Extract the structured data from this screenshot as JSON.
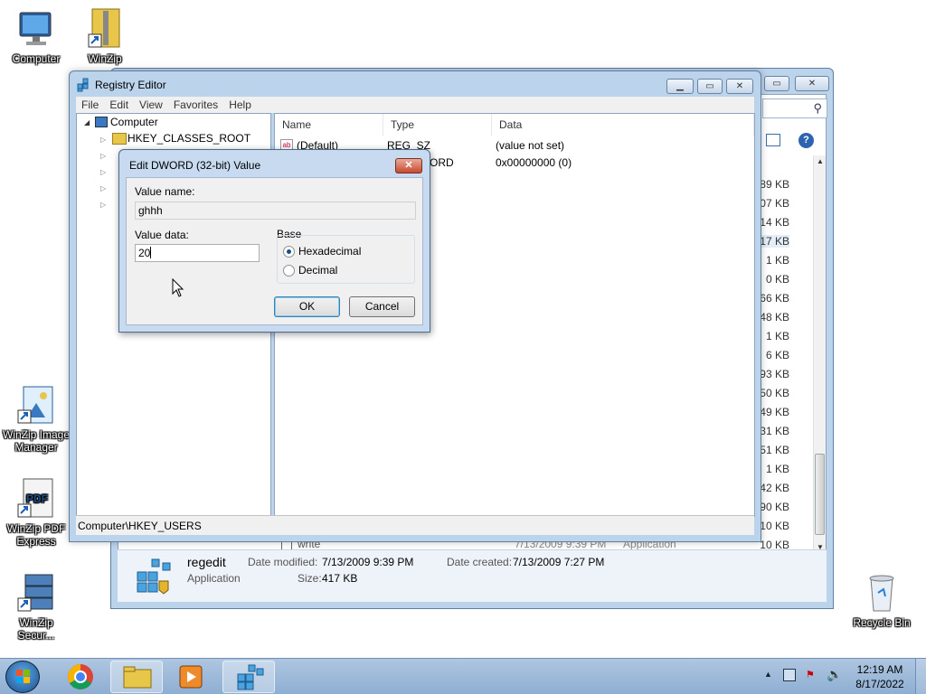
{
  "desktop": {
    "icons": [
      {
        "label": "Computer"
      },
      {
        "label": "WinZip"
      },
      {
        "label": "WinZip Image Manager"
      },
      {
        "label": "WinZip PDF Express"
      },
      {
        "label": "WinZip Secur..."
      },
      {
        "label": "Recycle Bin"
      }
    ]
  },
  "explorer": {
    "sizes": [
      "89 KB",
      "07 KB",
      "14 KB",
      "17 KB",
      "1 KB",
      "0 KB",
      "66 KB",
      "48 KB",
      "1 KB",
      "6 KB",
      "93 KB",
      "50 KB",
      "49 KB",
      "31 KB",
      "51 KB",
      "1 KB",
      "42 KB",
      "90 KB",
      "10 KB",
      "10 KB"
    ],
    "last_row": {
      "name": "write",
      "date": "7/13/2009 9:39 PM",
      "type": "Application"
    },
    "details": {
      "name": "regedit",
      "type": "Application",
      "modified_label": "Date modified:",
      "modified_value": "7/13/2009 9:39 PM",
      "created_label": "Date created:",
      "created_value": "7/13/2009 7:27 PM",
      "size_label": "Size:",
      "size_value": "417 KB"
    }
  },
  "regedit": {
    "title": "Registry Editor",
    "menu": [
      "File",
      "Edit",
      "View",
      "Favorites",
      "Help"
    ],
    "tree": {
      "root": "Computer",
      "first_key": "HKEY_CLASSES_ROOT"
    },
    "columns": {
      "name": "Name",
      "type": "Type",
      "data": "Data"
    },
    "rows": [
      {
        "name": "(Default)",
        "type": "REG_SZ",
        "data": "(value not set)"
      },
      {
        "name": "",
        "type": "ORD",
        "data": "0x00000000 (0)"
      }
    ],
    "status": "Computer\\HKEY_USERS"
  },
  "dialog": {
    "title": "Edit DWORD (32-bit) Value",
    "value_name_label": "Value name:",
    "value_name": "ghhh",
    "value_data_label": "Value data:",
    "value_data": "20",
    "base_label": "Base",
    "hex_label": "Hexadecimal",
    "dec_label": "Decimal",
    "ok": "OK",
    "cancel": "Cancel"
  },
  "taskbar": {
    "time": "12:19 AM",
    "date": "8/17/2022"
  }
}
